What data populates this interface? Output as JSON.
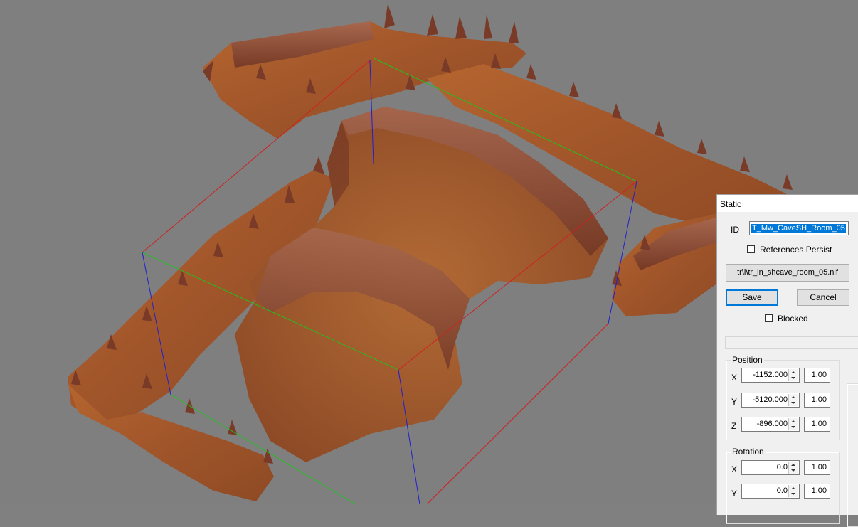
{
  "dialog": {
    "title": "Static",
    "id_label": "ID",
    "id_value": "T_Mw_CaveSH_Room_05",
    "references_persist_label": "References Persist",
    "model_button_label": "tr\\i\\tr_in_shcave_room_05.nif",
    "save_label": "Save",
    "cancel_label": "Cancel",
    "blocked_label": "Blocked"
  },
  "position": {
    "title": "Position",
    "x_label": "X",
    "x_value": "-1152.000",
    "x_scale": "1.00",
    "y_label": "Y",
    "y_value": "-5120.000",
    "y_scale": "1.00",
    "z_label": "Z",
    "z_value": "-896.000",
    "z_scale": "1.00"
  },
  "rotation": {
    "title": "Rotation",
    "x_label": "X",
    "x_value": "0.0",
    "x_scale": "1.00",
    "y_label": "Y",
    "y_value": "0.0",
    "y_scale": "1.00"
  },
  "colors": {
    "viewport_bg": "#7f7f7f",
    "terrain": "#a0522d",
    "axis_x": "#d02020",
    "axis_y": "#20c020",
    "axis_z": "#2020d0",
    "selection": "#0078d7"
  }
}
